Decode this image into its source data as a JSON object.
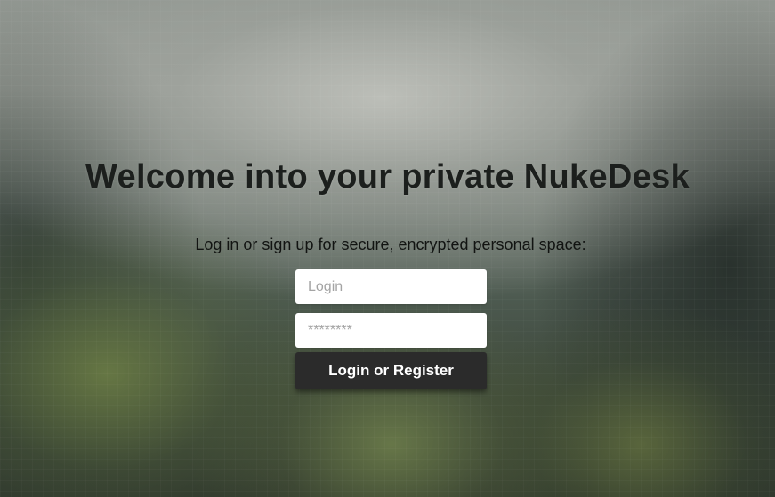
{
  "page": {
    "title": "Welcome into your private NukeDesk",
    "subtitle": "Log in or sign up for secure, encrypted personal space:"
  },
  "form": {
    "login_placeholder": "Login",
    "password_placeholder": "********",
    "submit_label": "Login or Register"
  },
  "colors": {
    "button_background": "#2b2b2b",
    "button_text": "#ffffff",
    "title_text": "#1c1f1d",
    "input_background": "#ffffff"
  }
}
